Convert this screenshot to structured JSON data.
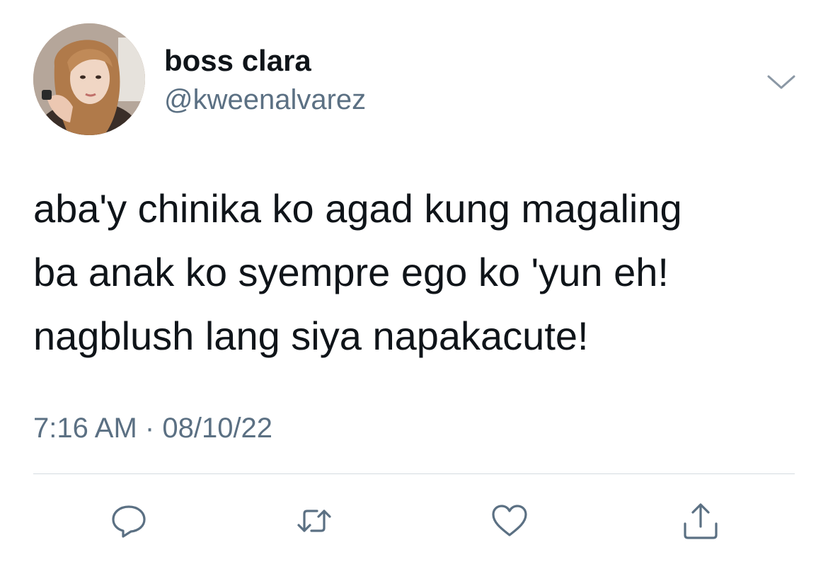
{
  "tweet": {
    "author": {
      "display_name": "boss clara",
      "handle": "@kweenalvarez"
    },
    "text_lines": [
      "aba'y chinika ko agad kung magaling",
      "ba anak ko syempre ego ko 'yun eh!",
      "nagblush lang siya napakacute!"
    ],
    "time": "7:16 AM",
    "separator": "·",
    "date": "08/10/22"
  },
  "actions": [
    {
      "icon": "reply-icon"
    },
    {
      "icon": "retweet-icon"
    },
    {
      "icon": "like-icon"
    },
    {
      "icon": "share-icon"
    }
  ],
  "colors": {
    "text_primary": "#0f1419",
    "text_secondary": "#5b7083",
    "divider": "#d4dbe0",
    "icon": "#5b7083"
  }
}
